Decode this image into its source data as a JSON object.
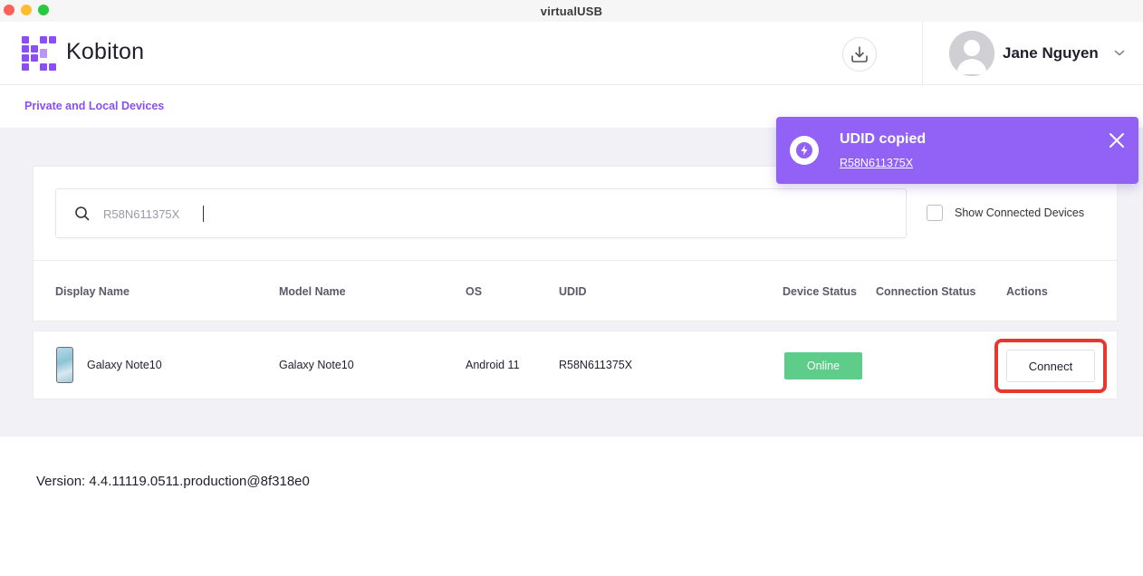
{
  "window": {
    "title": "virtualUSB"
  },
  "header": {
    "brand": "Kobiton",
    "user_name": "Jane Nguyen"
  },
  "subnav": {
    "link_label": "Private and Local Devices"
  },
  "search": {
    "value": "R58N611375X"
  },
  "filter": {
    "show_connected_label": "Show Connected Devices",
    "show_connected_checked": false
  },
  "table": {
    "headers": [
      "Display Name",
      "Model Name",
      "OS",
      "UDID",
      "Device Status",
      "Connection Status",
      "Actions"
    ],
    "rows": [
      {
        "display_name": "Galaxy Note10",
        "model_name": "Galaxy Note10",
        "os": "Android 11",
        "udid": "R58N611375X",
        "device_status": "Online",
        "connection_status": "",
        "action_label": "Connect"
      }
    ]
  },
  "footer": {
    "version": "Version: 4.4.11119.0511.production@8f318e0"
  },
  "toast": {
    "title": "UDID copied",
    "link_text": "R58N611375X"
  },
  "colors": {
    "accent": "#8a4ff0",
    "toast_bg": "#9162f5",
    "online": "#5fcd8a",
    "highlight": "#e8372e"
  }
}
